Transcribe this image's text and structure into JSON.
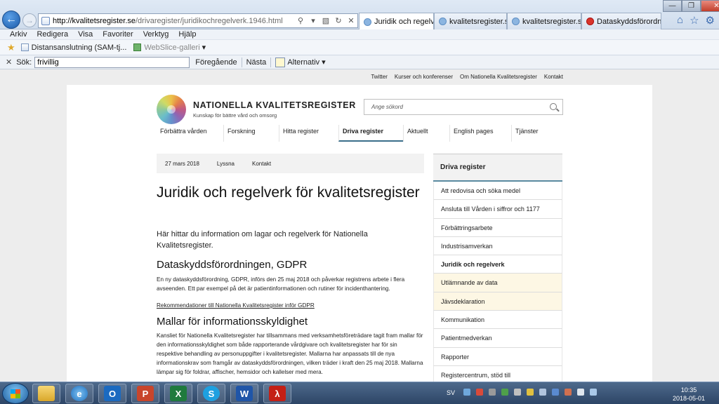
{
  "browser": {
    "url_host": "http://kvalitetsregister.se",
    "url_path": "/drivaregister/juridikochregelverk.1946.html",
    "tabs": [
      {
        "label": "Juridik och regelv..."
      },
      {
        "label": "kvalitetsregister.se"
      },
      {
        "label": "kvalitetsregister.se"
      },
      {
        "label": "Dataskyddsförordni..."
      }
    ],
    "menu": [
      "Arkiv",
      "Redigera",
      "Visa",
      "Favoriter",
      "Verktyg",
      "Hjälp"
    ],
    "favorites": [
      {
        "label": "Distansanslutning (SAM-tj..."
      },
      {
        "label": "WebSlice-galleri"
      }
    ],
    "find": {
      "label": "Sök:",
      "value": "frivillig",
      "prev": "Föregående",
      "next": "Nästa",
      "options": "Alternativ"
    }
  },
  "site": {
    "util_links": [
      "Twitter",
      "Kurser och konferenser",
      "Om Nationella Kvalitetsregister",
      "Kontakt"
    ],
    "brand": "NATIONELLA KVALITETSREGISTER",
    "tagline": "Kunskap för bättre vård och omsorg",
    "search_placeholder": "Ange sökord",
    "nav": [
      "Förbättra vården",
      "Forskning",
      "Hitta register",
      "Driva register",
      "Aktuellt",
      "English pages",
      "Tjänster"
    ],
    "info": {
      "date": "27 mars 2018",
      "listen": "Lyssna",
      "contact": "Kontakt"
    },
    "title": "Juridik och regelverk för kvalitetsregister",
    "lead": "Här hittar du information om lagar och regelverk för Nationella Kvalitetsregister.",
    "h2a": "Dataskyddsförordningen, GDPR",
    "p1": "En ny dataskyddsförordning, GDPR, införs den 25 maj 2018 och påverkar registrens arbete i flera avseenden. Ett par exempel på det är patientinformationen och rutiner för incidenthantering.",
    "link": "Rekommendationer till Nationella Kvalitetsregister inför GDPR",
    "h2b": "Mallar för informationsskyldighet",
    "p2": "Kansliet för Nationella Kvalitetsregister har tillsammans med verksamhetsföreträdare tagit fram mallar för den informationsskyldighet som både rapporterande vårdgivare och kvalitetsregister har för sin respektive behandling av personuppgifter i kvalitetsregister. Mallarna har anpassats till de nya informationskrav som framgår av dataskyddsförordningen, vilken träder i kraft den 25 maj 2018. Mallarna lämpar sig för foldrar, affischer, hemsidor och kallelser med mera.",
    "sidebar": {
      "heading": "Driva register",
      "items": [
        {
          "label": "Att redovisa och söka medel"
        },
        {
          "label": "Ansluta till Vården i siffror och 1177"
        },
        {
          "label": "Förbättringsarbete"
        },
        {
          "label": "Industrisamverkan"
        },
        {
          "label": "Juridik och regelverk"
        },
        {
          "label": "Utlämnande av data"
        },
        {
          "label": "Jävsdeklaration"
        },
        {
          "label": "Kommunikation"
        },
        {
          "label": "Patientmedverkan"
        },
        {
          "label": "Rapporter"
        },
        {
          "label": "Registercentrum, stöd till"
        }
      ]
    }
  },
  "taskbar": {
    "lang": "SV",
    "time": "10:35",
    "date": "2018-05-01"
  }
}
